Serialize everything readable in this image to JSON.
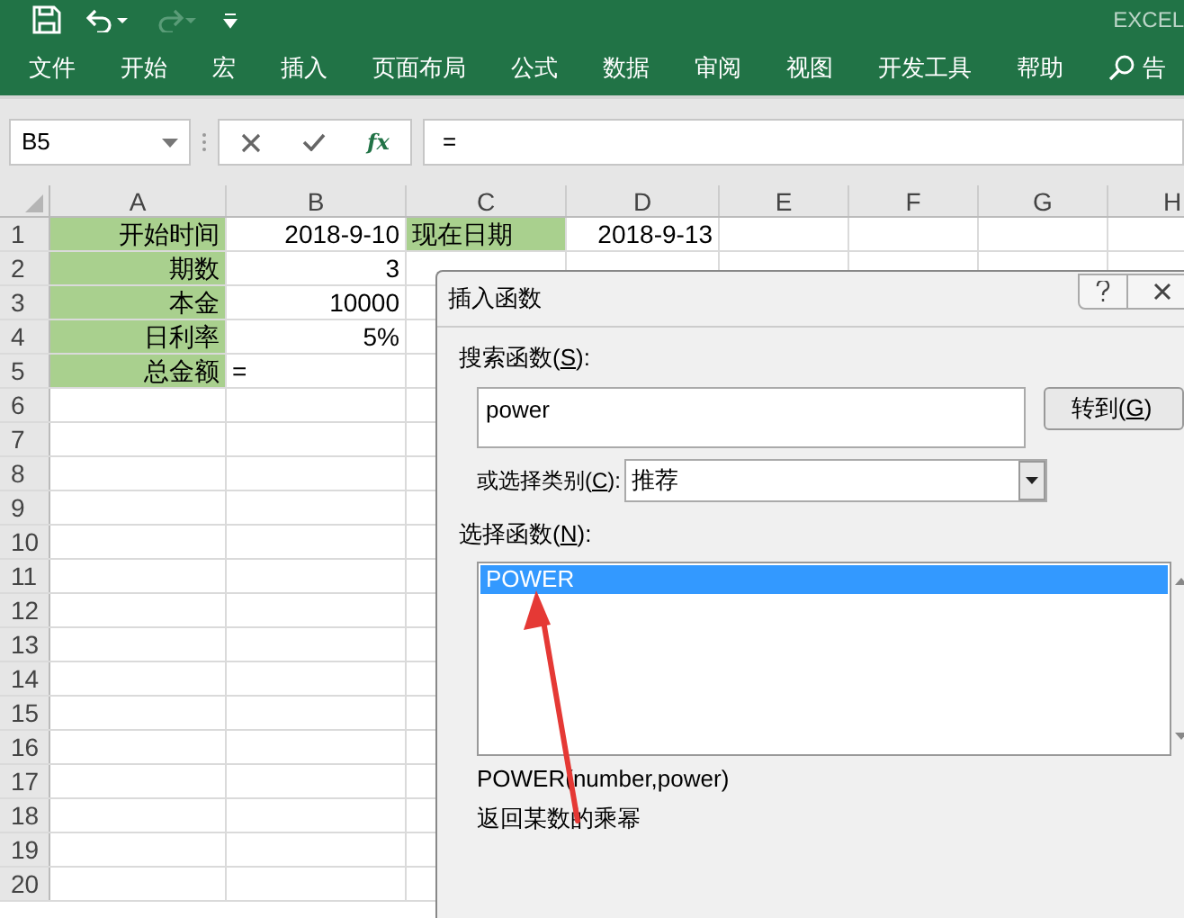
{
  "window": {
    "title": "EXCEL"
  },
  "quick_access": {
    "redo": {
      "disabled": true
    }
  },
  "ribbon_tabs": [
    {
      "label": "文件"
    },
    {
      "label": "开始"
    },
    {
      "label": "宏"
    },
    {
      "label": "插入"
    },
    {
      "label": "页面布局"
    },
    {
      "label": "公式"
    },
    {
      "label": "数据"
    },
    {
      "label": "审阅"
    },
    {
      "label": "视图"
    },
    {
      "label": "开发工具"
    },
    {
      "label": "帮助"
    }
  ],
  "tell_me": "告",
  "formula_bar": {
    "name_box": "B5",
    "function_button": "fx",
    "formula": "="
  },
  "sheet": {
    "columns": [
      "A",
      "B",
      "C",
      "D",
      "E",
      "F",
      "G",
      "H"
    ],
    "rows": [
      {
        "number": "1",
        "cells": [
          {
            "text": "开始时间",
            "kind": "label",
            "highlighted": true
          },
          {
            "text": "2018-9-10",
            "kind": "number",
            "highlighted": false
          },
          {
            "text": "现在日期",
            "kind": "text",
            "highlighted": true
          },
          {
            "text": "2018-9-13",
            "kind": "number",
            "highlighted": false
          }
        ]
      },
      {
        "number": "2",
        "cells": [
          {
            "text": "期数",
            "kind": "label",
            "highlighted": true
          },
          {
            "text": "3",
            "kind": "number",
            "highlighted": false
          }
        ]
      },
      {
        "number": "3",
        "cells": [
          {
            "text": "本金",
            "kind": "label",
            "highlighted": true
          },
          {
            "text": "10000",
            "kind": "number",
            "highlighted": false
          }
        ]
      },
      {
        "number": "4",
        "cells": [
          {
            "text": "日利率",
            "kind": "label",
            "highlighted": true
          },
          {
            "text": "5%",
            "kind": "number",
            "highlighted": false
          }
        ]
      },
      {
        "number": "5",
        "cells": [
          {
            "text": "总金额",
            "kind": "label",
            "highlighted": true
          },
          {
            "text": "=",
            "kind": "text",
            "highlighted": false
          }
        ]
      },
      {
        "number": "6",
        "cells": []
      },
      {
        "number": "7",
        "cells": []
      },
      {
        "number": "8",
        "cells": []
      },
      {
        "number": "9",
        "cells": []
      },
      {
        "number": "10",
        "cells": []
      },
      {
        "number": "11",
        "cells": []
      },
      {
        "number": "12",
        "cells": []
      },
      {
        "number": "13",
        "cells": []
      },
      {
        "number": "14",
        "cells": []
      },
      {
        "number": "15",
        "cells": []
      },
      {
        "number": "16",
        "cells": []
      },
      {
        "number": "17",
        "cells": []
      },
      {
        "number": "18",
        "cells": []
      },
      {
        "number": "19",
        "cells": []
      },
      {
        "number": "20",
        "cells": []
      }
    ]
  },
  "dialog": {
    "title": "插入函数",
    "search_label": {
      "text": "搜索函数(",
      "key": "S",
      "after": "):"
    },
    "search_value": "power",
    "go_button": {
      "text": "转到(",
      "key": "G",
      "after": ")"
    },
    "category_label": {
      "text": "或选择类别(",
      "key": "C",
      "after": "):"
    },
    "category_value": "推荐",
    "list_label": {
      "text": "选择函数(",
      "key": "N",
      "after": "):"
    },
    "functions": [
      {
        "name": "POWER",
        "selected": true
      }
    ],
    "signature": "POWER(number,power)",
    "description": "返回某数的乘幂"
  }
}
